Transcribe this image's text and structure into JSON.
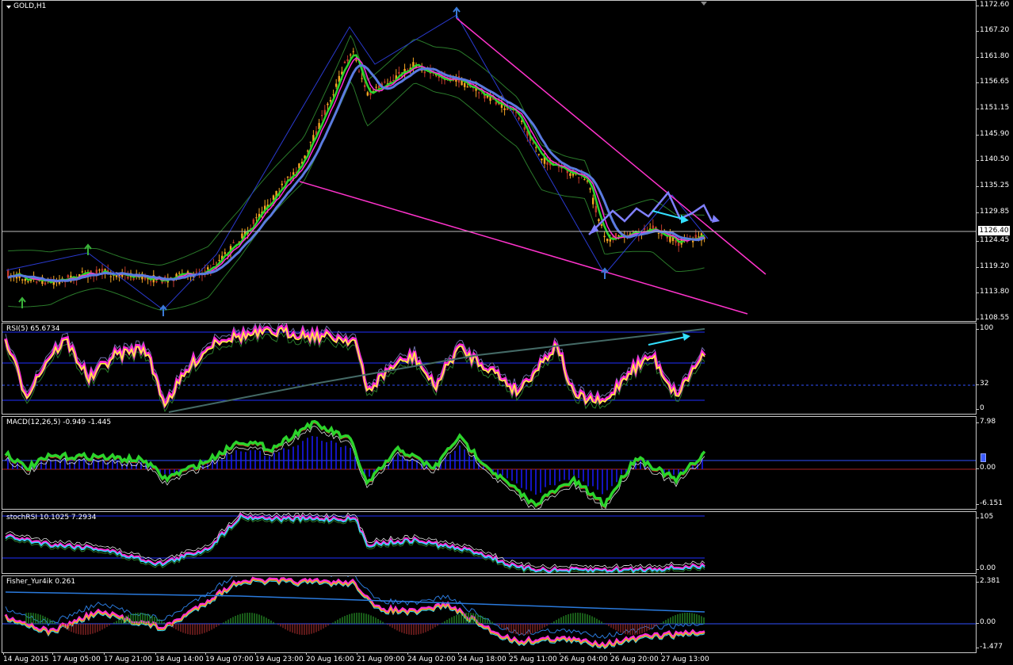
{
  "colors": {
    "background": "#000000",
    "candle_up": "#f5a623",
    "candle_down": "#c0392b",
    "ma_fast": "#2bd42b",
    "ma_mid": "#ff2bd9",
    "ma_slow": "#5b7be0",
    "channel": "#ff33cc",
    "band": "#2a7a2a",
    "rsi_line": "#ffff33",
    "cyan_arrow": "#33e0ff",
    "macd_hist": "#1a1aff",
    "zigzag": "#2a3ad0"
  },
  "main": {
    "label": "GOLD,H1",
    "price_scale": [
      "1172.60",
      "1167.20",
      "1161.80",
      "1156.65",
      "1151.15",
      "1145.90",
      "1140.50",
      "1135.25",
      "1129.85",
      "1124.45",
      "1119.20",
      "1113.80",
      "1108.55"
    ],
    "current_price": "1126.40"
  },
  "rsi": {
    "label": "RSI(5) 65.6734",
    "scale": [
      "100",
      "32",
      "0"
    ]
  },
  "macd": {
    "label": "MACD(12,26,5) -0.949 -1.445",
    "scale": [
      "7.98",
      "0.00",
      "-6.151"
    ]
  },
  "stochrsi": {
    "label": "stochRSI 10.1025 7.2934",
    "scale": [
      "105",
      "0.00"
    ]
  },
  "fisher": {
    "label": "Fisher_Yur4ik 0.261",
    "scale": [
      "2.381",
      "0.00",
      "-1.477"
    ]
  },
  "time_axis": [
    "14 Aug 2015",
    "17 Aug 05:00",
    "17 Aug 21:00",
    "18 Aug 14:00",
    "19 Aug 07:00",
    "19 Aug 23:00",
    "20 Aug 16:00",
    "21 Aug 09:00",
    "24 Aug 02:00",
    "24 Aug 18:00",
    "25 Aug 11:00",
    "26 Aug 04:00",
    "26 Aug 20:00",
    "27 Aug 13:00"
  ],
  "icons": {
    "menu": "triangle-down-icon",
    "scroll": "shift-arrow-icon"
  }
}
